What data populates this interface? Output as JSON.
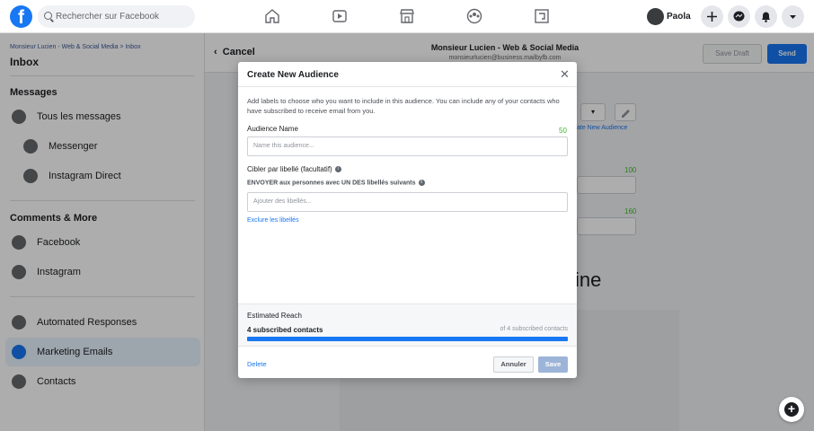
{
  "topbar": {
    "logo": "f",
    "search_placeholder": "Rechercher sur Facebook",
    "nav_icons": [
      "home-icon",
      "watch-icon",
      "marketplace-icon",
      "groups-icon",
      "gaming-icon"
    ],
    "profile_name": "Paola",
    "actions": [
      "plus-icon",
      "messenger-icon",
      "notifications-icon",
      "account-menu-icon"
    ]
  },
  "sidebar": {
    "breadcrumb": "Monsieur Lucien - Web & Social Media > Inbox",
    "title": "Inbox",
    "messages_header": "Messages",
    "messages_items": [
      {
        "label": "Tous les messages",
        "icon": "chat-bubbles-icon"
      },
      {
        "label": "Messenger",
        "icon": "messenger-icon"
      },
      {
        "label": "Instagram Direct",
        "icon": "instagram-direct-icon"
      }
    ],
    "comments_header": "Comments & More",
    "comments_items": [
      {
        "label": "Facebook",
        "icon": "facebook-icon"
      },
      {
        "label": "Instagram",
        "icon": "instagram-icon"
      }
    ],
    "bottom_items": [
      {
        "label": "Automated Responses",
        "icon": "automation-icon"
      },
      {
        "label": "Marketing Emails",
        "icon": "email-icon",
        "active": true
      },
      {
        "label": "Contacts",
        "icon": "contacts-icon"
      }
    ]
  },
  "main": {
    "cancel_label": "Cancel",
    "page_name": "Monsieur Lucien - Web & Social Media",
    "page_email": "monsieurlucien@business.mailbyfb.com",
    "save_draft_label": "Save Draft",
    "send_label": "Send",
    "create_audience_link": "ate New Audience",
    "count_1": "100",
    "count_2": "160",
    "big_text": "ine"
  },
  "modal": {
    "title": "Create New Audience",
    "description": "Add labels to choose who you want to include in this audience. You can include any of your contacts who have subscribed to receive email from you.",
    "audience_name_label": "Audience Name",
    "audience_name_count": "50",
    "audience_name_placeholder": "Name this audience...",
    "target_label": "Cibler par libellé (facultatif)",
    "target_sub": "ENVOYER aux personnes avec UN DES libellés suivants",
    "labels_placeholder": "Ajouter des libellés...",
    "exclude_link": "Exclure les libellés",
    "estimated_reach_label": "Estimated Reach",
    "subscribed_contacts": "4 subscribed contacts",
    "of_contacts": "of 4 subscribed contacts",
    "reach_fraction": 1.0,
    "delete_label": "Delete",
    "cancel_label": "Annuler",
    "save_label": "Save",
    "colors": {
      "accent": "#1877f2",
      "count": "#42b72a"
    }
  }
}
